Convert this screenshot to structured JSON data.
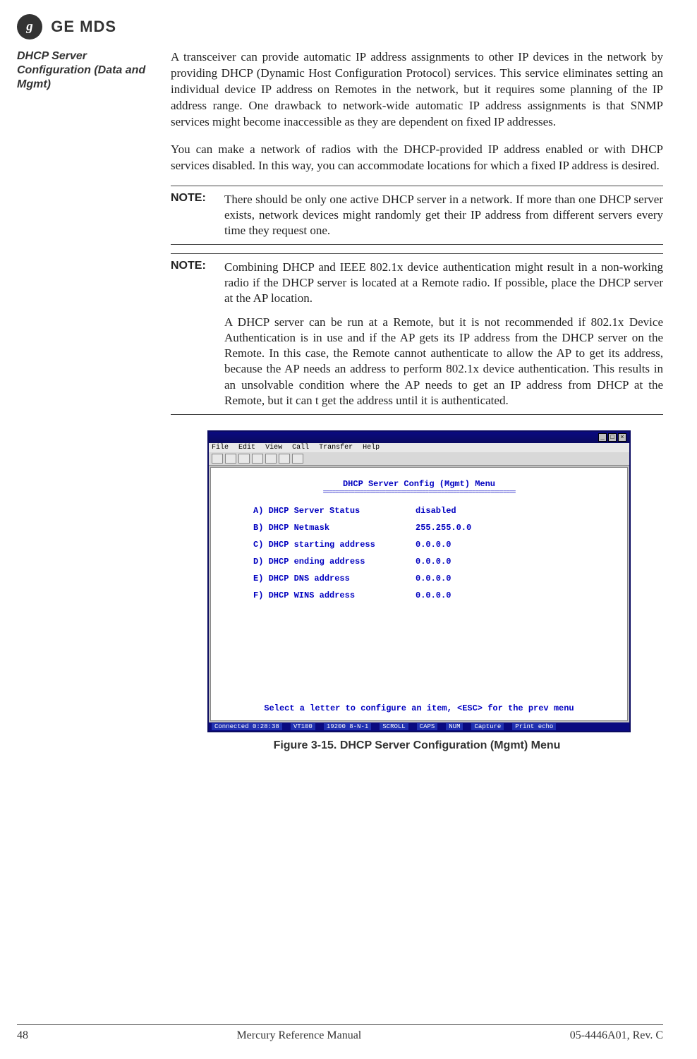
{
  "brand": {
    "logo_text": "g",
    "name": "GE MDS"
  },
  "section_heading": "DHCP Server Configuration (Data and Mgmt)",
  "paragraphs": {
    "p1": "A transceiver can provide automatic IP address assignments to other IP devices in the network by providing DHCP (Dynamic Host Configuration Protocol) services. This service eliminates setting an individual device IP address on Remotes in the network, but it requires some planning of the IP address range. One drawback to network-wide automatic IP address assignments is that SNMP services might become inaccessible as they are dependent on fixed IP addresses.",
    "p2": "You can make a network of radios with the DHCP-provided IP address enabled or with DHCP services disabled. In this way, you can accommodate locations for which a fixed IP address is desired."
  },
  "note_label": "NOTE:",
  "note1": "There should be only one active DHCP server in a network. If more than one DHCP server exists, network devices might randomly get their IP address from different servers every time they request one.",
  "note2a": "Combining DHCP and IEEE 802.1x device authentication might result in a non-working radio if the DHCP server is located at a Remote radio. If possible, place the DHCP server at the AP location.",
  "note2b": "A DHCP server can be run at a Remote, but it is not recommended if 802.1x Device Authentication is in use and if the AP gets its IP address from the DHCP server on the Remote. In this case, the Remote cannot authenticate to allow the AP to get its address, because the AP needs an address to perform 802.1x device authentication. This results in an unsolvable condition where the AP needs to get an IP address from DHCP at the Remote, but it can t get the address until it is authenticated.",
  "terminal": {
    "menubar": {
      "m1": "File",
      "m2": "Edit",
      "m3": "View",
      "m4": "Call",
      "m5": "Transfer",
      "m6": "Help"
    },
    "title": "DHCP Server Config (Mgmt) Menu",
    "rows": [
      {
        "label": "A) DHCP Server Status",
        "value": "disabled"
      },
      {
        "label": "B) DHCP Netmask",
        "value": "255.255.0.0"
      },
      {
        "label": "C) DHCP starting address",
        "value": "0.0.0.0"
      },
      {
        "label": "D) DHCP ending address",
        "value": "0.0.0.0"
      },
      {
        "label": "E) DHCP DNS address",
        "value": "0.0.0.0"
      },
      {
        "label": "F) DHCP WINS address",
        "value": "0.0.0.0"
      }
    ],
    "hint": "Select a letter to configure an item, <ESC> for the prev menu",
    "status": {
      "s1": "Connected 0:28:38",
      "s2": "VT100",
      "s3": "19200 8-N-1",
      "s4": "SCROLL",
      "s5": "CAPS",
      "s6": "NUM",
      "s7": "Capture",
      "s8": "Print echo"
    }
  },
  "figure_caption": "Figure 3-15. DHCP Server Configuration (Mgmt) Menu",
  "footer": {
    "page": "48",
    "title": "Mercury Reference Manual",
    "doc": "05-4446A01, Rev. C"
  }
}
